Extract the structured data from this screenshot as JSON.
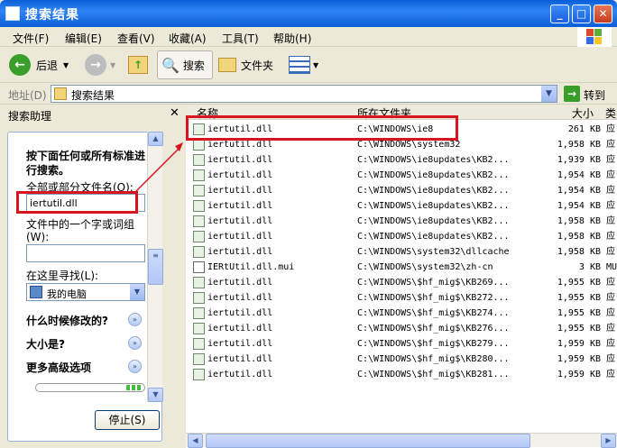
{
  "window": {
    "title": "搜索结果"
  },
  "menu": [
    "文件(F)",
    "编辑(E)",
    "查看(V)",
    "收藏(A)",
    "工具(T)",
    "帮助(H)"
  ],
  "toolbar": {
    "back": "后退",
    "search": "搜索",
    "folders": "文件夹"
  },
  "address": {
    "label": "地址(D)",
    "value": "搜索结果",
    "go": "转到"
  },
  "pane": {
    "title": "搜索助理",
    "heading": "按下面任何或所有标准进行搜索。",
    "filename_label": "全部或部分文件名(O):",
    "filename_value": "iertutil.dll",
    "phrase_label": "文件中的一个字或词组(W):",
    "phrase_value": "",
    "lookin_label": "在这里寻找(L):",
    "lookin_value": "我的电脑",
    "when_modified": "什么时候修改的?",
    "what_size": "大小是?",
    "advanced": "更多高级选项",
    "stop_button": "停止(S)"
  },
  "columns": {
    "name": "名称",
    "folder": "所在文件夹",
    "size": "大小",
    "type": "类"
  },
  "results": [
    {
      "name": "iertutil.dll",
      "folder": "C:\\WINDOWS\\ie8",
      "size": "261 KB",
      "type": "应",
      "icon": "dll-icon"
    },
    {
      "name": "iertutil.dll",
      "folder": "C:\\WINDOWS\\system32",
      "size": "1,958 KB",
      "type": "应",
      "icon": "dll-icon"
    },
    {
      "name": "iertutil.dll",
      "folder": "C:\\WINDOWS\\ie8updates\\KB2...",
      "size": "1,939 KB",
      "type": "应",
      "icon": "dll-icon"
    },
    {
      "name": "iertutil.dll",
      "folder": "C:\\WINDOWS\\ie8updates\\KB2...",
      "size": "1,954 KB",
      "type": "应",
      "icon": "dll-icon"
    },
    {
      "name": "iertutil.dll",
      "folder": "C:\\WINDOWS\\ie8updates\\KB2...",
      "size": "1,954 KB",
      "type": "应",
      "icon": "dll-icon"
    },
    {
      "name": "iertutil.dll",
      "folder": "C:\\WINDOWS\\ie8updates\\KB2...",
      "size": "1,954 KB",
      "type": "应",
      "icon": "dll-icon"
    },
    {
      "name": "iertutil.dll",
      "folder": "C:\\WINDOWS\\ie8updates\\KB2...",
      "size": "1,958 KB",
      "type": "应",
      "icon": "dll-icon"
    },
    {
      "name": "iertutil.dll",
      "folder": "C:\\WINDOWS\\ie8updates\\KB2...",
      "size": "1,958 KB",
      "type": "应",
      "icon": "dll-icon"
    },
    {
      "name": "iertutil.dll",
      "folder": "C:\\WINDOWS\\system32\\dllcache",
      "size": "1,958 KB",
      "type": "应",
      "icon": "dll-icon"
    },
    {
      "name": "IERtUtil.dll.mui",
      "folder": "C:\\WINDOWS\\system32\\zh-cn",
      "size": "3 KB",
      "type": "MU",
      "icon": "mui-icon"
    },
    {
      "name": "iertutil.dll",
      "folder": "C:\\WINDOWS\\$hf_mig$\\KB269...",
      "size": "1,955 KB",
      "type": "应",
      "icon": "dll-icon"
    },
    {
      "name": "iertutil.dll",
      "folder": "C:\\WINDOWS\\$hf_mig$\\KB272...",
      "size": "1,955 KB",
      "type": "应",
      "icon": "dll-icon"
    },
    {
      "name": "iertutil.dll",
      "folder": "C:\\WINDOWS\\$hf_mig$\\KB274...",
      "size": "1,955 KB",
      "type": "应",
      "icon": "dll-icon"
    },
    {
      "name": "iertutil.dll",
      "folder": "C:\\WINDOWS\\$hf_mig$\\KB276...",
      "size": "1,955 KB",
      "type": "应",
      "icon": "dll-icon"
    },
    {
      "name": "iertutil.dll",
      "folder": "C:\\WINDOWS\\$hf_mig$\\KB279...",
      "size": "1,959 KB",
      "type": "应",
      "icon": "dll-icon"
    },
    {
      "name": "iertutil.dll",
      "folder": "C:\\WINDOWS\\$hf_mig$\\KB280...",
      "size": "1,959 KB",
      "type": "应",
      "icon": "dll-icon"
    },
    {
      "name": "iertutil.dll",
      "folder": "C:\\WINDOWS\\$hf_mig$\\KB281...",
      "size": "1,959 KB",
      "type": "应",
      "icon": "dll-icon"
    }
  ],
  "colors": {
    "titlebar": "#0a5fd8",
    "highlight": "#d8141e"
  }
}
